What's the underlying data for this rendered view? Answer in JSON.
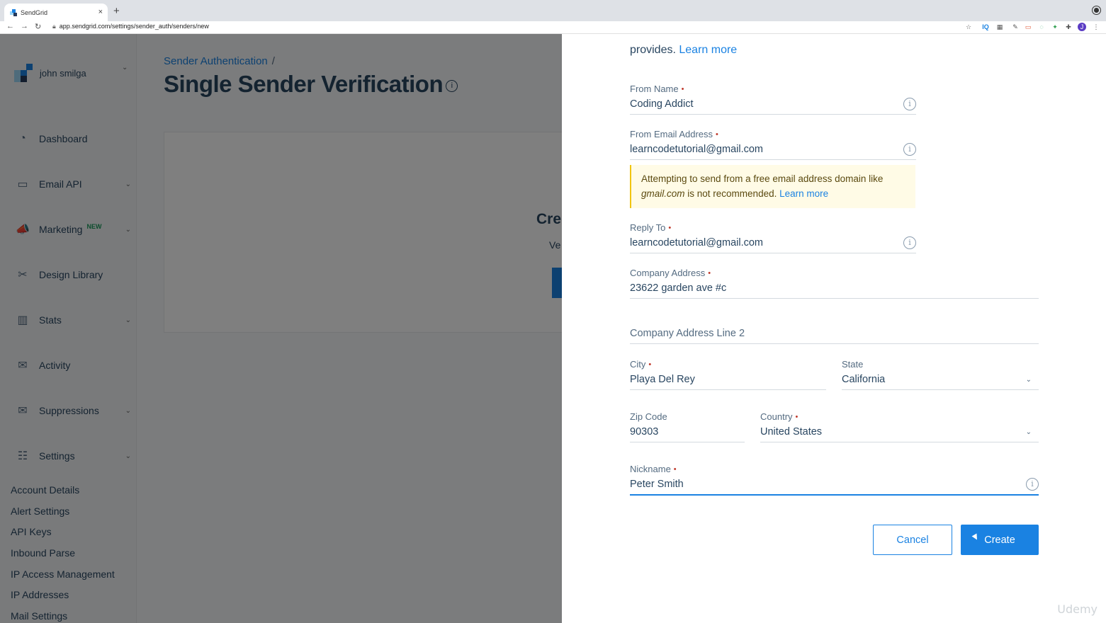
{
  "browser": {
    "tab_title": "SendGrid",
    "close_glyph": "×",
    "new_tab_glyph": "+",
    "url": "app.sendgrid.com/settings/sender_auth/senders/new",
    "extensions": [
      "☆",
      "IQ",
      "▦",
      "✎",
      "▭",
      "◌",
      "✦",
      "✚",
      "J",
      "⋮"
    ]
  },
  "sidebar": {
    "user_name": "john smilga",
    "items": [
      {
        "label": "Dashboard",
        "icon": "gauge-icon",
        "glyph": "◔",
        "chevron": false
      },
      {
        "label": "Email API",
        "icon": "card-icon",
        "glyph": "▭",
        "chevron": true
      },
      {
        "label": "Marketing",
        "icon": "megaphone-icon",
        "glyph": "📣",
        "chevron": true,
        "badge": "NEW"
      },
      {
        "label": "Design Library",
        "icon": "tools-icon",
        "glyph": "✂",
        "chevron": false
      },
      {
        "label": "Stats",
        "icon": "bar-chart-icon",
        "glyph": "▥",
        "chevron": true
      },
      {
        "label": "Activity",
        "icon": "envelope-search-icon",
        "glyph": "✉",
        "chevron": false
      },
      {
        "label": "Suppressions",
        "icon": "envelope-block-icon",
        "glyph": "✉",
        "chevron": true
      },
      {
        "label": "Settings",
        "icon": "sliders-icon",
        "glyph": "☷",
        "chevron": true
      }
    ],
    "sub_items": [
      "Account Details",
      "Alert Settings",
      "API Keys",
      "Inbound Parse",
      "IP Access Management",
      "IP Addresses",
      "Mail Settings"
    ]
  },
  "main": {
    "breadcrumb": "Sender Authentication",
    "breadcrumb_sep": "/",
    "title": "Single Sender Verification",
    "card_title_partial": "Cre",
    "card_text_partial": "Ve"
  },
  "form": {
    "intro_text": "provides.",
    "intro_link": "Learn more",
    "from_name": {
      "label": "From Name",
      "value": "Coding Addict"
    },
    "from_email": {
      "label": "From Email Address",
      "value": "learncodetutorial@gmail.com"
    },
    "warning": {
      "text_before": "Attempting to send from a free email address domain like",
      "domain": "gmail.com",
      "text_after": "is not recommended.",
      "link": "Learn more"
    },
    "reply_to": {
      "label": "Reply To",
      "value": "learncodetutorial@gmail.com"
    },
    "company_address": {
      "label": "Company Address",
      "value": "23622 garden ave #c"
    },
    "company_address_2": {
      "label": "Company Address Line 2",
      "value": ""
    },
    "city": {
      "label": "City",
      "value": "Playa Del Rey"
    },
    "state": {
      "label": "State",
      "value": "California"
    },
    "zip": {
      "label": "Zip Code",
      "value": "90303"
    },
    "country": {
      "label": "Country",
      "value": "United States"
    },
    "nickname": {
      "label": "Nickname",
      "value": "Peter Smith"
    },
    "required_mark": "•",
    "info_glyph": "i",
    "caret_glyph": "⌄",
    "cancel_label": "Cancel",
    "create_label": "Create"
  },
  "watermark": "Udemy",
  "colors": {
    "accent": "#1a82e2",
    "required": "#c0392b",
    "warning_bg": "#fffbe6"
  }
}
